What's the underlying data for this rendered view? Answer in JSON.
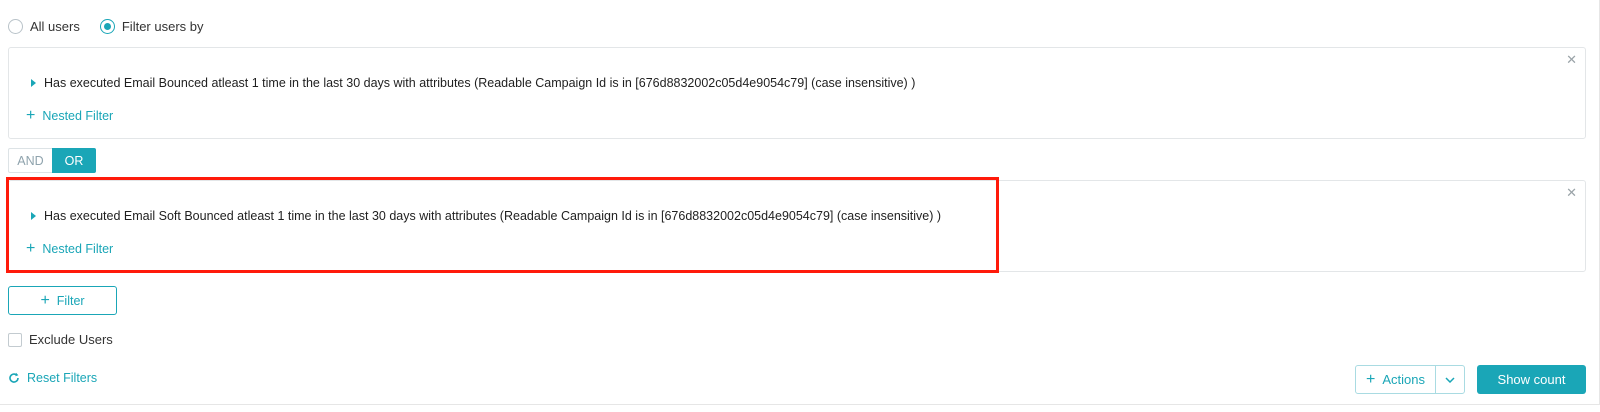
{
  "user_scope": {
    "options": [
      {
        "label": "All users",
        "selected": false
      },
      {
        "label": "Filter users by",
        "selected": true
      }
    ]
  },
  "filters": [
    {
      "condition": "Has executed Email Bounced atleast 1 time in the last 30 days with attributes (Readable Campaign Id  is in [676d8832002c05d4e9054c79]  (case insensitive) )",
      "nested_label": "Nested Filter",
      "close_glyph": "✕"
    },
    {
      "condition": "Has executed Email Soft Bounced atleast 1 time in the last 30 days with attributes (Readable Campaign Id  is in [676d8832002c05d4e9054c79]  (case insensitive) )",
      "nested_label": "Nested Filter",
      "close_glyph": "✕"
    }
  ],
  "logic_toggle": {
    "and_label": "AND",
    "or_label": "OR",
    "selected": "OR"
  },
  "add_filter_label": "Filter",
  "exclude_users_label": "Exclude Users",
  "reset_filters_label": "Reset Filters",
  "actions_label": "Actions",
  "show_count_label": "Show count",
  "icons": {
    "plus": "+",
    "caret": "caret-right-icon",
    "reset": "refresh-icon",
    "dropdown": "chevron-down-icon"
  },
  "colors": {
    "accent": "#1aa6b7",
    "highlight": "#ff1a0a"
  }
}
